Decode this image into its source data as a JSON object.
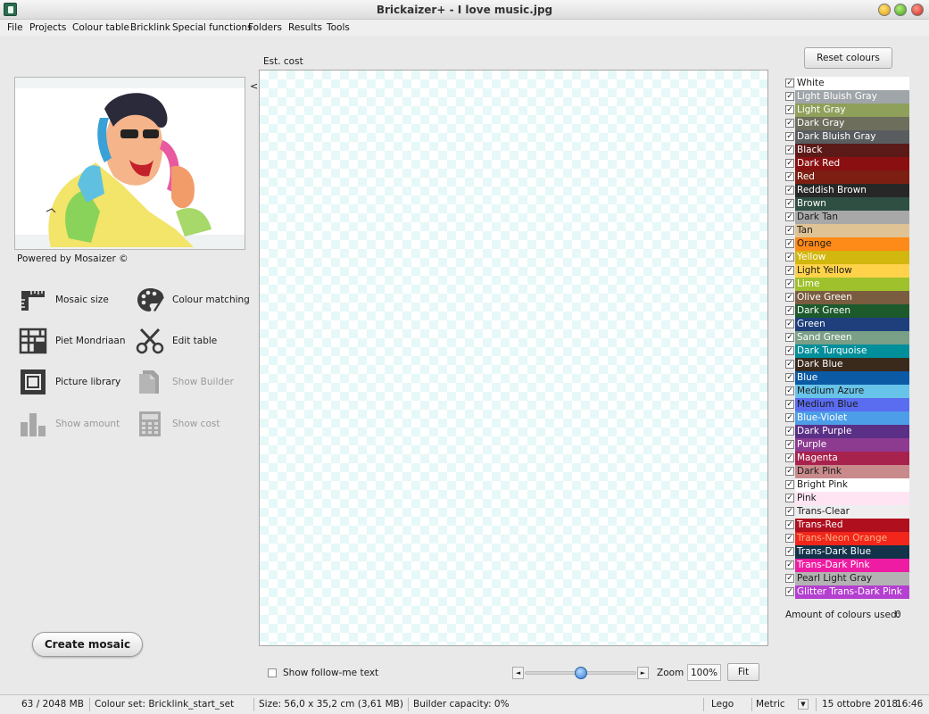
{
  "window": {
    "title": "Brickaizer+  - I love music.jpg"
  },
  "menu": [
    "File",
    "Projects",
    "Colour table",
    "Bricklink",
    "Special functions",
    "Folders",
    "Results",
    "Tools"
  ],
  "left_panel": {
    "collapse": "<",
    "powered_by": "Powered by Mosaizer ©",
    "tools": {
      "mosaic_size": "Mosaic size",
      "colour_matching": "Colour matching",
      "piet_mondriaan": "Piet Mondriaan",
      "edit_table": "Edit table",
      "picture_library": "Picture library",
      "show_builder": "Show Builder",
      "show_amount": "Show amount",
      "show_cost": "Show cost"
    },
    "create_button": "Create mosaic"
  },
  "canvas": {
    "est_cost": "Est. cost"
  },
  "bottom_controls": {
    "follow_me": "Show follow-me text",
    "follow_me_checked": false,
    "zoom_label": "Zoom",
    "zoom_value": "100%",
    "zoom_slider_fraction": 0.5,
    "fit_button": "Fit",
    "left_arrow": "◄",
    "right_arrow": "►"
  },
  "right_panel": {
    "reset_button": "Reset colours",
    "check_glyph": "✓",
    "colours": [
      {
        "name": "White",
        "bg": "#ffffff",
        "fg": "#1a1a1a",
        "checked": true
      },
      {
        "name": "Light Bluish Gray",
        "bg": "#a0a5a9",
        "fg": "#ffffff",
        "checked": true
      },
      {
        "name": "Light Gray",
        "bg": "#8fa05a",
        "fg": "#ffffff",
        "checked": true
      },
      {
        "name": "Dark Gray",
        "bg": "#6d6e5c",
        "fg": "#ffffff",
        "checked": true
      },
      {
        "name": "Dark Bluish Gray",
        "bg": "#595d60",
        "fg": "#ffffff",
        "checked": true
      },
      {
        "name": "Black",
        "bg": "#5b1a18",
        "fg": "#ffffff",
        "checked": true
      },
      {
        "name": "Dark Red",
        "bg": "#8a0f10",
        "fg": "#ffffff",
        "checked": true
      },
      {
        "name": "Red",
        "bg": "#7c1e12",
        "fg": "#ffffff",
        "checked": true
      },
      {
        "name": "Reddish Brown",
        "bg": "#272727",
        "fg": "#ffffff",
        "checked": true
      },
      {
        "name": "Brown",
        "bg": "#2f4f43",
        "fg": "#ffffff",
        "checked": true
      },
      {
        "name": "Dark Tan",
        "bg": "#a8a8a8",
        "fg": "#1a1a1a",
        "checked": true
      },
      {
        "name": "Tan",
        "bg": "#dfc395",
        "fg": "#1a1a1a",
        "checked": true
      },
      {
        "name": "Orange",
        "bg": "#fe8a18",
        "fg": "#1a1a1a",
        "checked": true
      },
      {
        "name": "Yellow",
        "bg": "#d2b70e",
        "fg": "#ffffff",
        "checked": true
      },
      {
        "name": "Light Yellow",
        "bg": "#ffd24a",
        "fg": "#1a1a1a",
        "checked": true
      },
      {
        "name": "Lime",
        "bg": "#9fc12c",
        "fg": "#ffffff",
        "checked": true
      },
      {
        "name": "Olive Green",
        "bg": "#7a5c40",
        "fg": "#ffffff",
        "checked": true
      },
      {
        "name": "Dark Green",
        "bg": "#1c5a2c",
        "fg": "#ffffff",
        "checked": true
      },
      {
        "name": "Green",
        "bg": "#1e3f7c",
        "fg": "#ffffff",
        "checked": true
      },
      {
        "name": "Sand Green",
        "bg": "#7a9f87",
        "fg": "#ffffff",
        "checked": true
      },
      {
        "name": "Dark Turquoise",
        "bg": "#008f9b",
        "fg": "#ffffff",
        "checked": true
      },
      {
        "name": "Dark Blue",
        "bg": "#3a2a1c",
        "fg": "#ffffff",
        "checked": true
      },
      {
        "name": "Blue",
        "bg": "#0a5aa6",
        "fg": "#ffffff",
        "checked": true
      },
      {
        "name": "Medium Azure",
        "bg": "#68c3e8",
        "fg": "#1a1a1a",
        "checked": true
      },
      {
        "name": "Medium Blue",
        "bg": "#5a6cf0",
        "fg": "#1a1a1a",
        "checked": true
      },
      {
        "name": "Blue-Violet",
        "bg": "#4c9ee8",
        "fg": "#ffffff",
        "checked": true
      },
      {
        "name": "Dark Purple",
        "bg": "#5a2f86",
        "fg": "#ffffff",
        "checked": true
      },
      {
        "name": "Purple",
        "bg": "#8d3a91",
        "fg": "#ffffff",
        "checked": true
      },
      {
        "name": "Magenta",
        "bg": "#a8224e",
        "fg": "#ffffff",
        "checked": true
      },
      {
        "name": "Dark Pink",
        "bg": "#c98a8c",
        "fg": "#1a1a1a",
        "checked": true
      },
      {
        "name": "Bright Pink",
        "bg": "#ffffff",
        "fg": "#1a1a1a",
        "checked": true
      },
      {
        "name": "Pink",
        "bg": "#ffe4f4",
        "fg": "#1a1a1a",
        "checked": true
      },
      {
        "name": "Trans-Clear",
        "bg": "#eeeeee",
        "fg": "#1a1a1a",
        "checked": true
      },
      {
        "name": "Trans-Red",
        "bg": "#b00f1e",
        "fg": "#ffffff",
        "checked": true
      },
      {
        "name": "Trans-Neon Orange",
        "bg": "#f2261a",
        "fg": "#ffb38a",
        "checked": true
      },
      {
        "name": "Trans-Dark Blue",
        "bg": "#12334a",
        "fg": "#ffffff",
        "checked": true
      },
      {
        "name": "Trans-Dark Pink",
        "bg": "#ee1ca2",
        "fg": "#ffffff",
        "checked": true
      },
      {
        "name": "Pearl Light Gray",
        "bg": "#b3b3b3",
        "fg": "#1a1a1a",
        "checked": true
      },
      {
        "name": "Glitter Trans-Dark Pink",
        "bg": "#b43fd0",
        "fg": "#ffffff",
        "checked": true
      }
    ],
    "amount_label": "Amount of colours used:",
    "amount_value": "0"
  },
  "status": {
    "memory": "63 / 2048 MB",
    "colour_set": "Colour set: Bricklink_start_set",
    "size": "Size: 56,0 x 35,2 cm (3,61 MB)",
    "builder_capacity": "Builder capacity: 0%",
    "brand": "Lego",
    "units": "Metric",
    "units_dropdown": "▼",
    "date": "15 ottobre 2018",
    "time": "16:46"
  }
}
